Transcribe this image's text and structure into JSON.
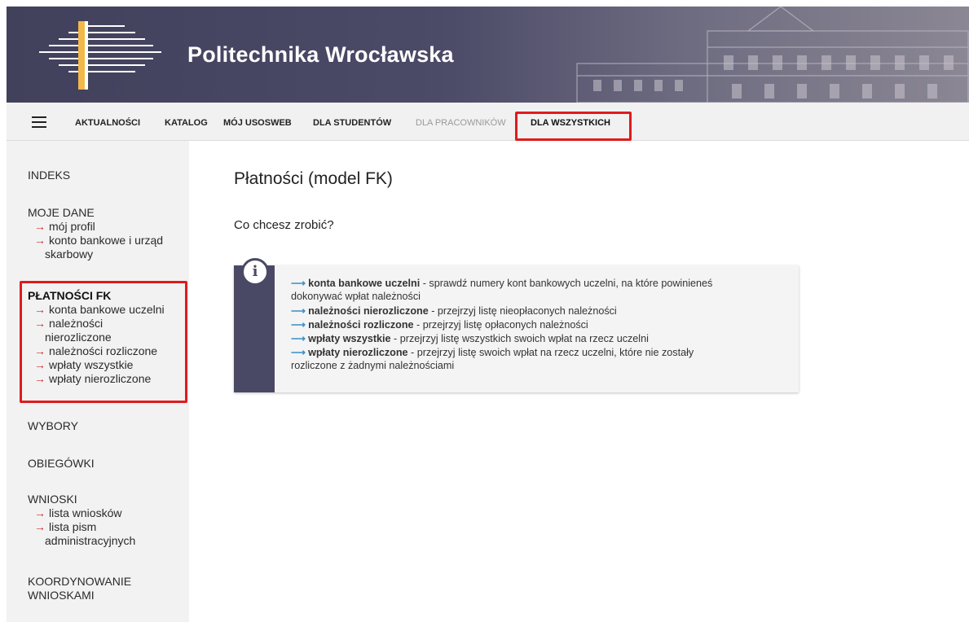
{
  "header": {
    "brand": "Politechnika Wrocławska",
    "logo_icon": "pwr-logo-icon",
    "background_color": "#41415c"
  },
  "topnav": {
    "menu_icon": "hamburger-icon",
    "items": [
      {
        "label": "AKTUALNOŚCI",
        "state": "normal"
      },
      {
        "label": "KATALOG",
        "state": "normal"
      },
      {
        "label": "MÓJ USOSWEB",
        "state": "normal"
      },
      {
        "label": "DLA STUDENTÓW",
        "state": "normal"
      },
      {
        "label": "DLA PRACOWNIKÓW",
        "state": "disabled"
      },
      {
        "label": "DLA WSZYSTKICH",
        "state": "active"
      }
    ],
    "active_underline_color": "#f0b94a",
    "highlight_color": "#e01b1b"
  },
  "sidebar": {
    "indeks": "INDEKS",
    "moje_dane": {
      "title": "MOJE DANE",
      "links": [
        "mój profil",
        "konto bankowe i urząd",
        "skarbowy"
      ]
    },
    "platnosci": {
      "title": "PŁATNOŚCI FK",
      "links": [
        "konta bankowe uczelni",
        "należności",
        "nierozliczone",
        "należności rozliczone",
        "wpłaty wszystkie",
        "wpłaty nierozliczone"
      ]
    },
    "wybory": "WYBORY",
    "obiegowki": "OBIEGÓWKI",
    "wnioski": {
      "title": "WNIOSKI",
      "links": [
        "lista wniosków",
        "lista pism",
        "administracyjnych"
      ]
    },
    "koordynowanie": [
      "KOORDYNOWANIE",
      "WNIOSKAMI"
    ],
    "arrow_glyph": "→"
  },
  "main": {
    "title": "Płatności (model FK)",
    "subtitle": "Co chcesz zrobić?",
    "info": {
      "icon": "info-icon",
      "arrow": "⟶",
      "items": [
        {
          "link": "konta bankowe uczelni",
          "desc": " - sprawdź numery kont bankowych uczelni, na które powinieneś",
          "cont": "dokonywać wpłat należności"
        },
        {
          "link": "należności nierozliczone",
          "desc": " - przejrzyj listę nieopłaconych należności"
        },
        {
          "link": "należności rozliczone",
          "desc": " - przejrzyj listę opłaconych należności"
        },
        {
          "link": "wpłaty wszystkie",
          "desc": " - przejrzyj listę wszystkich swoich wpłat na rzecz uczelni"
        },
        {
          "link": "wpłaty nierozliczone",
          "desc": " - przejrzyj listę swoich wpłat na rzecz uczelni, które nie zostały",
          "cont": "rozliczone z żadnymi należnościami"
        }
      ]
    }
  }
}
